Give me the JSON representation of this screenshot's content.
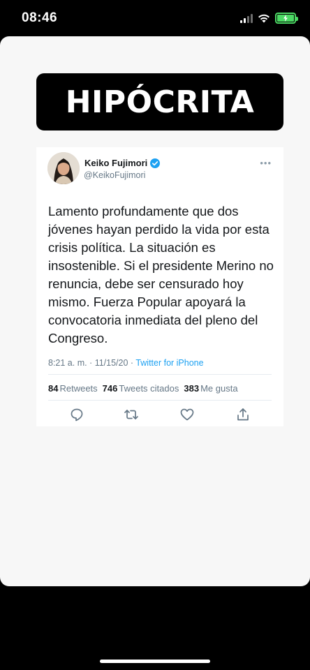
{
  "status_bar": {
    "time": "08:46",
    "battery_color": "#4cd964"
  },
  "headline": "HIPÓCRITA",
  "tweet": {
    "author_name": "Keiko Fujimori",
    "handle": "@KeikoFujimori",
    "verified": true,
    "body": "Lamento profundamente que dos jóvenes hayan perdido la vida por esta crisis política. La situación es insostenible. Si el presidente Merino no renuncia, debe ser censurado hoy mismo. Fuerza Popular apoyará la convocatoria inmediata del pleno del Congreso.",
    "timestamp": "8:21 a. m. · 11/15/20 · ",
    "source": "Twitter for iPhone",
    "link_color": "#1da1f2",
    "stats": {
      "retweets_count": "84",
      "retweets_label": "Retweets",
      "quotes_count": "746",
      "quotes_label": "Tweets citados",
      "likes_count": "383",
      "likes_label": "Me gusta"
    },
    "actions": [
      "reply-icon",
      "retweet-icon",
      "like-icon",
      "share-icon"
    ]
  }
}
